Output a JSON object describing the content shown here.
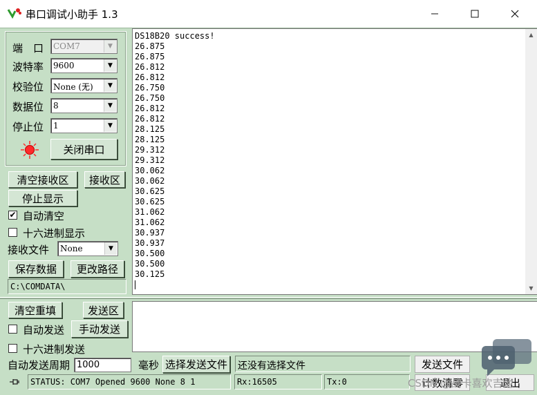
{
  "window": {
    "title": "串口调试小助手 1.3",
    "minimize_icon": "minimize-icon",
    "maximize_icon": "maximize-icon",
    "close_icon": "close-icon"
  },
  "config": {
    "port_label": "端　口",
    "port_value": "COM7",
    "baud_label": "波特率",
    "baud_value": "9600",
    "parity_label": "校验位",
    "parity_value": "None (无)",
    "databits_label": "数据位",
    "databits_value": "8",
    "stopbits_label": "停止位",
    "stopbits_value": "1",
    "close_port_button": "关闭串口"
  },
  "receive": {
    "clear_button": "清空接收区",
    "area_button": "接收区",
    "stop_display_button": "停止显示",
    "auto_clear_label": "自动清空",
    "auto_clear_checked": true,
    "hex_display_label": "十六进制显示",
    "hex_display_checked": false,
    "file_label": "接收文件",
    "file_value": "None",
    "save_button": "保存数据",
    "change_path_button": "更改路径",
    "path": "C:\\COMDATA\\",
    "lines": [
      "DS18B20 success!",
      "26.875",
      "26.875",
      "26.812",
      "26.812",
      "26.750",
      "26.750",
      "26.812",
      "26.812",
      "28.125",
      "28.125",
      "29.312",
      "29.312",
      "30.062",
      "30.062",
      "30.625",
      "30.625",
      "31.062",
      "31.062",
      "30.937",
      "30.937",
      "30.500",
      "30.500",
      "30.125"
    ]
  },
  "send": {
    "clear_button": "清空重填",
    "area_button": "发送区",
    "auto_send_label": "自动发送",
    "auto_send_checked": false,
    "manual_send_button": "手动发送",
    "hex_send_label": "十六进制发送",
    "hex_send_checked": false,
    "period_label": "自动发送周期",
    "period_value": "1000",
    "period_unit": "毫秒",
    "select_file_button": "选择发送文件",
    "file_status": "还没有选择文件",
    "send_file_button": "发送文件"
  },
  "status": {
    "status_text": "STATUS: COM7 Opened 9600 None  8 1",
    "rx_text": "Rx:16505",
    "tx_text": "Tx:0",
    "count_clear_button": "计数清零",
    "exit_button": "退出"
  },
  "watermark": "CSDN @战卡喜欢吉他",
  "colors": {
    "panel_bg": "#c6dfc6",
    "led_red": "#ff2a2a"
  }
}
